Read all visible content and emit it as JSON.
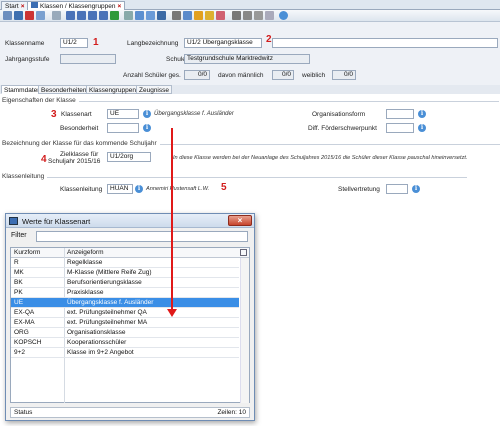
{
  "tabs": [
    {
      "label": "Start"
    },
    {
      "label": "Klassen / Klassengruppen"
    }
  ],
  "header": {
    "klassenname_label": "Klassenname",
    "klassenname_value": "U1/2",
    "langbez_label": "Langbezeichnung",
    "langbez_value": "U1/2 Übergangsklasse",
    "jahrgangsstufe_label": "Jahrgangsstufe",
    "schule_label": "Schule",
    "schule_value": "Testgrundschule Marktredwitz",
    "anzahl_label": "Anzahl Schüler ges.",
    "anzahl_value": "0/0",
    "maennlich_label": "davon männlich",
    "maennlich_value": "0/0",
    "weiblich_label": "weiblich",
    "weiblich_value": "0/0"
  },
  "markers": {
    "m1": "1",
    "m2": "2",
    "m3": "3",
    "m4": "4",
    "m5": "5"
  },
  "subtabs": [
    "Stammdaten",
    "Besonderheiten",
    "Klassengruppen",
    "Zeugnisse"
  ],
  "eigenschaften": {
    "section": "Eigenschaften der Klasse",
    "klassenart_label": "Klassenart",
    "klassenart_value": "UE",
    "klassenart_desc": "Übergangsklasse f. Ausländer",
    "organisationsform_label": "Organisationsform",
    "besonderheit_label": "Besonderheit",
    "foerder_label": "Diff. Förderschwerpunkt"
  },
  "bezeichnung": {
    "section": "Bezeichnung der Klasse für das kommende Schuljahr",
    "zielklasse_label1": "Zielklasse für",
    "zielklasse_label2": "Schuljahr 2015/16",
    "zielklasse_value": "U1/2org",
    "note": "In diese Klasse werden bei der Neuanlage des Schuljahres 2015/16 die Schüler dieser Klasse pauschal hineinversetzt."
  },
  "klassenleitung": {
    "section": "Klassenleitung",
    "label": "Klassenleitung",
    "value": "HUAN",
    "name": "Annemiri Hustensaft L.W.",
    "stellvertretung_label": "Stellvertretung"
  },
  "dialog": {
    "title": "Werte für Klassenart",
    "filter_label": "Filter",
    "col1": "Kurzform",
    "col2": "Anzeigeform",
    "rows": [
      {
        "k": "R",
        "a": "Regelklasse"
      },
      {
        "k": "MK",
        "a": "M-Klasse (Mittlere Reife Zug)"
      },
      {
        "k": "BK",
        "a": "Berufsorientierungsklasse"
      },
      {
        "k": "PK",
        "a": "Praxisklasse"
      },
      {
        "k": "UE",
        "a": "Übergangsklasse f. Ausländer"
      },
      {
        "k": "EX-QA",
        "a": "ext. Prüfungsteilnehmer QA"
      },
      {
        "k": "EX-MA",
        "a": "ext. Prüfungsteilnehmer MA"
      },
      {
        "k": "ORG",
        "a": "Organisationsklasse"
      },
      {
        "k": "KOPSCH",
        "a": "Kooperationsschüler"
      },
      {
        "k": "9+2",
        "a": "Klasse im 9+2 Angebot"
      }
    ],
    "selected_index": 4,
    "status_label": "Status",
    "rows_count": "Zeilen: 10"
  },
  "colors": {
    "accent": "#3a8ee6",
    "marker": "#d21b1b"
  }
}
